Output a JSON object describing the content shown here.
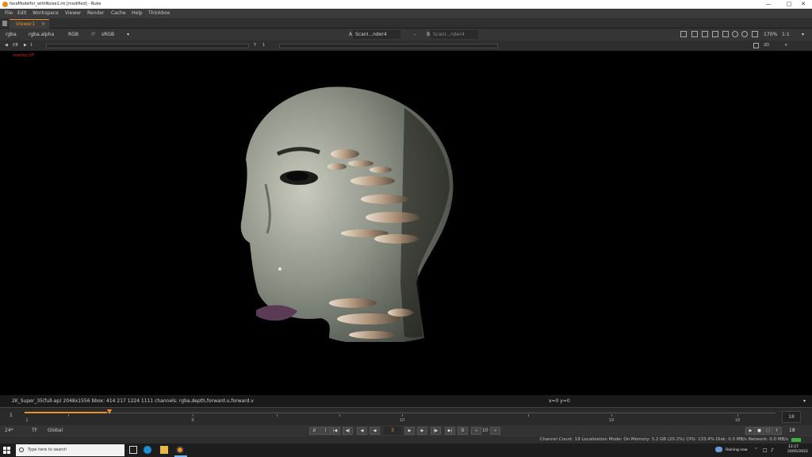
{
  "window": {
    "title": "faceModelfor_withNoise1.nk [modified] - Nuke",
    "controls": [
      "—",
      "□",
      "✕"
    ]
  },
  "menu": [
    "File",
    "Edit",
    "Workspace",
    "Viewer",
    "Render",
    "Cache",
    "Help",
    "Thinkbox"
  ],
  "tab": {
    "label": "Viewer1",
    "close": "✕"
  },
  "toolbar": {
    "channels": "rgba",
    "alpha_channel": "rgba.alpha",
    "display": "RGB",
    "ip": "IP",
    "lut": "sRGB",
    "input_a_letter": "A",
    "input_a": "ScanI...nder4",
    "operator": "-",
    "input_b_letter": "B",
    "input_b": "ScanI...nder4",
    "zoom": "170%",
    "ratio": "1:1"
  },
  "toolbar2": {
    "fstop": "f/8",
    "gain": "1",
    "y_label": "Y",
    "gamma": "1",
    "view_mode": "2D"
  },
  "viewer": {
    "overlay_status": "overlay off"
  },
  "info": {
    "format": "2K_Super_35(full-ap) 2048x1556  bbox: 414 217 1224 1111 channels: rgba,depth,forward.u,forward.v",
    "coords": "x=0 y=0"
  },
  "timeline": {
    "labels": [
      "1",
      "9",
      "10",
      "19",
      "18"
    ],
    "current": "18",
    "end": "18",
    "first_frame": "1",
    "progress": 0.11
  },
  "transport": {
    "fps": "24*",
    "tf": "TF",
    "scope": "Global",
    "frame": "3",
    "step": "10"
  },
  "status": {
    "text": "Channel Count: 19  Localization Mode: On  Memory: 3.2 GB (20.2%)  CPU: 133.4%  Disk: 0.0 MB/s  Network: 0.0 MB/s"
  },
  "taskbar": {
    "search_placeholder": "Type here to search",
    "weather": "Raining now",
    "time": "12:27",
    "date": "20/05/2022"
  }
}
